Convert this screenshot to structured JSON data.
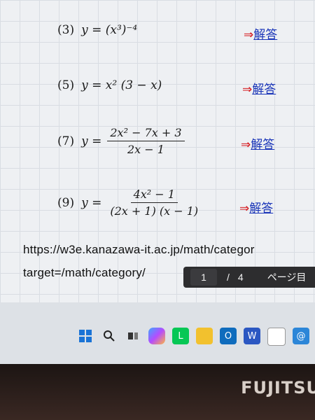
{
  "problems": [
    {
      "number": "(3)",
      "lhs": "y =",
      "expr": "(x³)⁻⁴",
      "answer_arrow": "⇒",
      "answer_label": "解答"
    },
    {
      "number": "(5)",
      "lhs": "y =",
      "expr": "x² (3 − x)",
      "answer_arrow": "⇒",
      "answer_label": "解答"
    },
    {
      "number": "(7)",
      "lhs": "y =",
      "numerator": "2x² − 7x + 3",
      "denominator": "2x − 1",
      "answer_arrow": "⇒",
      "answer_label": "解答"
    },
    {
      "number": "(9)",
      "lhs": "y =",
      "numerator": "4x² − 1",
      "denominator": "(2x + 1) (x − 1)",
      "answer_arrow": "⇒",
      "answer_label": "解答"
    }
  ],
  "url": {
    "line1": "https://w3e.kanazawa-it.ac.jp/math/categor",
    "line2": "target=/math/category/"
  },
  "pdf_toolbar": {
    "current_page": "1",
    "separator": "/",
    "total_pages": "4",
    "label": "ページ目"
  },
  "taskbar": {
    "icons": [
      "windows-start-icon",
      "search-icon",
      "task-view-icon",
      "copilot-icon",
      "line-app-icon",
      "file-explorer-icon",
      "outlook-icon",
      "word-icon",
      "app-icon",
      "mail-icon"
    ]
  },
  "brand": "FUJITSU"
}
